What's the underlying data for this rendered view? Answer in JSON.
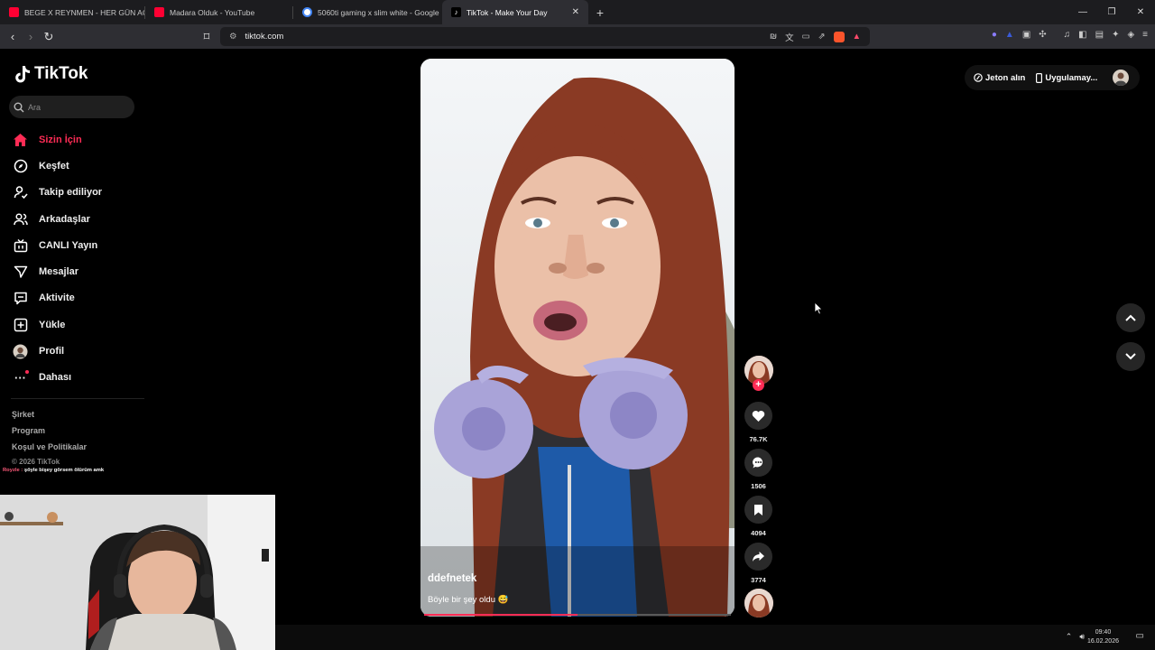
{
  "browser": {
    "tabs": [
      {
        "title": "BEGE X REYNMEN - HER GÜN AC",
        "icon": "youtube-icon",
        "color": "#ff0033"
      },
      {
        "title": "Madara Olduk - YouTube",
        "icon": "youtube-icon",
        "color": "#ff0033"
      },
      {
        "title": "5060ti gaming x slim white - Google",
        "icon": "google-icon",
        "color": "#ffffff"
      },
      {
        "title": "TikTok - Make Your Day",
        "icon": "tiktok-icon",
        "color": "#000000"
      }
    ],
    "url": "tiktok.com"
  },
  "tiktok": {
    "logo_text": "TikTok",
    "search_placeholder": "Ara",
    "nav": [
      {
        "label": "Sizin İçin",
        "icon": "home-icon",
        "active": true
      },
      {
        "label": "Keşfet",
        "icon": "compass-icon"
      },
      {
        "label": "Takip ediliyor",
        "icon": "following-icon"
      },
      {
        "label": "Arkadaşlar",
        "icon": "friends-icon"
      },
      {
        "label": "CANLI Yayın",
        "icon": "live-icon"
      },
      {
        "label": "Mesajlar",
        "icon": "message-icon"
      },
      {
        "label": "Aktivite",
        "icon": "activity-icon"
      },
      {
        "label": "Yükle",
        "icon": "upload-icon"
      },
      {
        "label": "Profil",
        "icon": "profile-avatar"
      },
      {
        "label": "Dahası",
        "icon": "more-icon"
      }
    ],
    "footer": {
      "company": "Şirket",
      "program": "Program",
      "terms": "Koşul ve Politikalar",
      "copyright": "© 2026 TikTok"
    },
    "top_right": {
      "coins": "Jeton alın",
      "app": "Uygulamay..."
    },
    "video": {
      "username": "ddefnetek",
      "caption": "Böyle bir şey oldu 😅",
      "progress": 0.5
    },
    "actions": {
      "likes": "76.7K",
      "comments": "1506",
      "saves": "4094",
      "shares": "3774"
    }
  },
  "stream": {
    "chat_user": "Royzle :",
    "chat_message": "şöyle bişey görsem ölürüm amk"
  },
  "taskbar": {
    "time": "09:40",
    "date": "16.02.2026"
  },
  "colors": {
    "accent": "#fe2c55"
  }
}
